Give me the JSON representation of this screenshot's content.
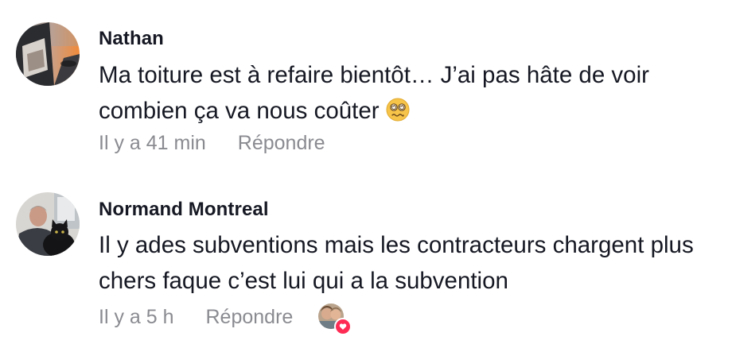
{
  "comments": [
    {
      "username": "Nathan",
      "text": "Ma toiture est à refaire bientôt… J’ai pas hâte de voir combien ça va nous coûter",
      "emoji": "dizzy-face-emoji",
      "time": "Il y a 41 min",
      "reply_label": "Répondre"
    },
    {
      "username": "Normand Montreal",
      "text": "Il y ades subventions mais les contracteurs chargent plus chers faque c’est lui qui a la subvention",
      "time": "Il y a 5 h",
      "reply_label": "Répondre",
      "creator_liked": true
    }
  ],
  "colors": {
    "text": "#161823",
    "meta": "#8a8b91",
    "heart": "#fe2c55"
  }
}
